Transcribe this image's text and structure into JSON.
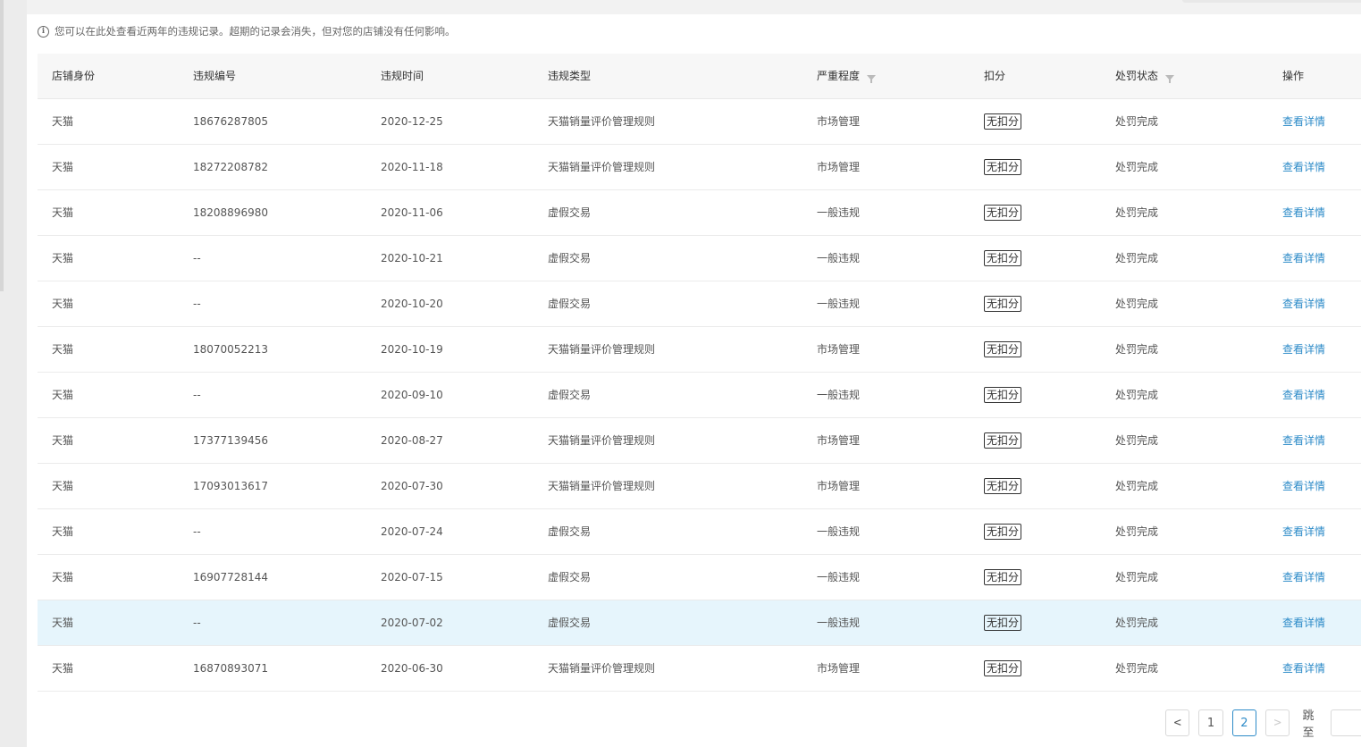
{
  "notice": {
    "icon": "info-icon",
    "text": "您可以在此处查看近两年的违规记录。超期的记录会消失，但对您的店铺没有任何影响。"
  },
  "table": {
    "columns": {
      "shop_identity": "店铺身份",
      "violation_id": "违规编号",
      "violation_time": "违规时间",
      "violation_type": "违规类型",
      "severity": "严重程度",
      "deduction": "扣分",
      "status": "处罚状态",
      "action": "操作"
    },
    "rows": [
      {
        "shop": "天猫",
        "id": "18676287805",
        "time": "2020-12-25",
        "type": "天猫销量评价管理规则",
        "severity": "市场管理",
        "deduction": "无扣分",
        "status": "处罚完成",
        "action": "查看详情"
      },
      {
        "shop": "天猫",
        "id": "18272208782",
        "time": "2020-11-18",
        "type": "天猫销量评价管理规则",
        "severity": "市场管理",
        "deduction": "无扣分",
        "status": "处罚完成",
        "action": "查看详情"
      },
      {
        "shop": "天猫",
        "id": "18208896980",
        "time": "2020-11-06",
        "type": "虚假交易",
        "severity": "一般违规",
        "deduction": "无扣分",
        "status": "处罚完成",
        "action": "查看详情"
      },
      {
        "shop": "天猫",
        "id": "--",
        "time": "2020-10-21",
        "type": "虚假交易",
        "severity": "一般违规",
        "deduction": "无扣分",
        "status": "处罚完成",
        "action": "查看详情"
      },
      {
        "shop": "天猫",
        "id": "--",
        "time": "2020-10-20",
        "type": "虚假交易",
        "severity": "一般违规",
        "deduction": "无扣分",
        "status": "处罚完成",
        "action": "查看详情"
      },
      {
        "shop": "天猫",
        "id": "18070052213",
        "time": "2020-10-19",
        "type": "天猫销量评价管理规则",
        "severity": "市场管理",
        "deduction": "无扣分",
        "status": "处罚完成",
        "action": "查看详情"
      },
      {
        "shop": "天猫",
        "id": "--",
        "time": "2020-09-10",
        "type": "虚假交易",
        "severity": "一般违规",
        "deduction": "无扣分",
        "status": "处罚完成",
        "action": "查看详情"
      },
      {
        "shop": "天猫",
        "id": "17377139456",
        "time": "2020-08-27",
        "type": "天猫销量评价管理规则",
        "severity": "市场管理",
        "deduction": "无扣分",
        "status": "处罚完成",
        "action": "查看详情"
      },
      {
        "shop": "天猫",
        "id": "17093013617",
        "time": "2020-07-30",
        "type": "天猫销量评价管理规则",
        "severity": "市场管理",
        "deduction": "无扣分",
        "status": "处罚完成",
        "action": "查看详情"
      },
      {
        "shop": "天猫",
        "id": "--",
        "time": "2020-07-24",
        "type": "虚假交易",
        "severity": "一般违规",
        "deduction": "无扣分",
        "status": "处罚完成",
        "action": "查看详情"
      },
      {
        "shop": "天猫",
        "id": "16907728144",
        "time": "2020-07-15",
        "type": "虚假交易",
        "severity": "一般违规",
        "deduction": "无扣分",
        "status": "处罚完成",
        "action": "查看详情"
      },
      {
        "shop": "天猫",
        "id": "--",
        "time": "2020-07-02",
        "type": "虚假交易",
        "severity": "一般违规",
        "deduction": "无扣分",
        "status": "处罚完成",
        "action": "查看详情",
        "highlighted": true
      },
      {
        "shop": "天猫",
        "id": "16870893071",
        "time": "2020-06-30",
        "type": "天猫销量评价管理规则",
        "severity": "市场管理",
        "deduction": "无扣分",
        "status": "处罚完成",
        "action": "查看详情"
      }
    ]
  },
  "pagination": {
    "prev_icon": "chevron-left-icon",
    "next_icon": "chevron-right-icon",
    "pages": [
      "1",
      "2"
    ],
    "current_page": "2",
    "jump_label": "跳至",
    "jump_value": ""
  },
  "colors": {
    "link": "#2d8bc8",
    "highlight_row": "#e6f5fc",
    "header_bg": "#f7f7f7"
  }
}
